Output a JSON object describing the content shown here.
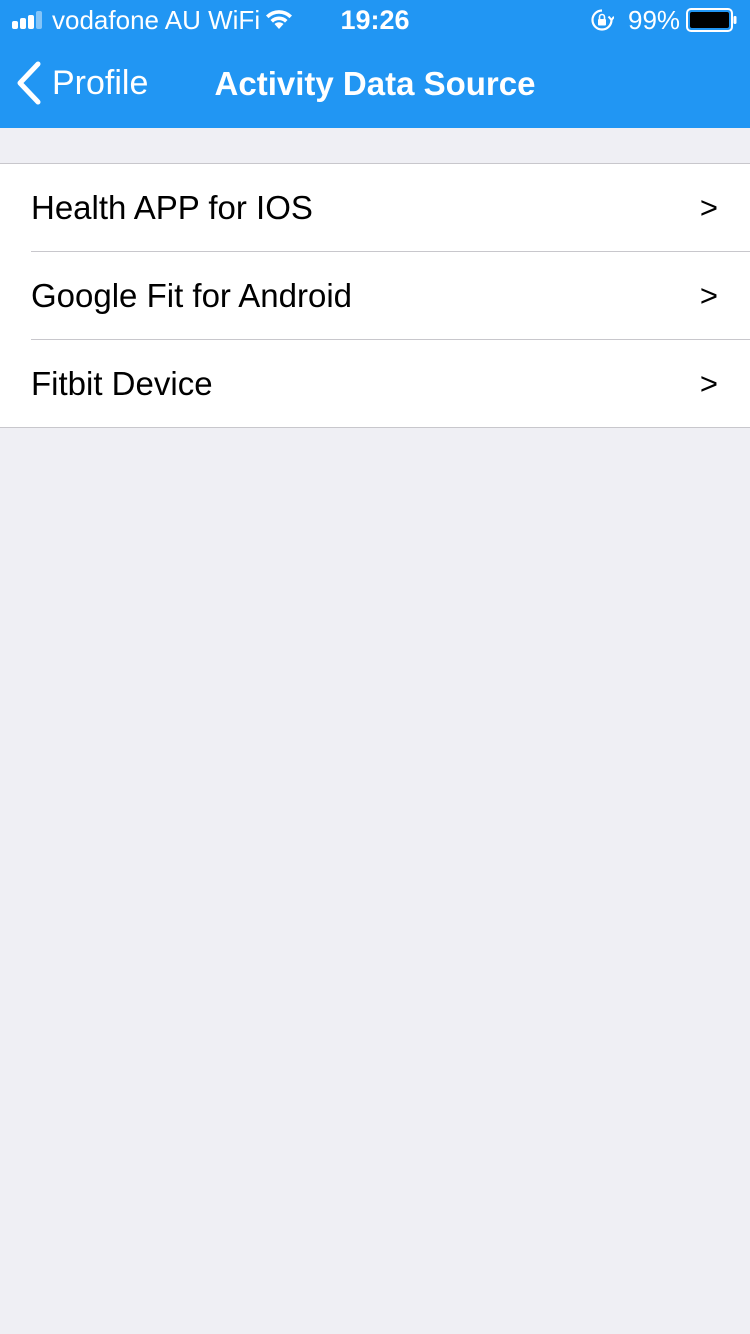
{
  "status_bar": {
    "carrier": "vodafone AU WiFi",
    "time": "19:26",
    "battery_percent": "99%",
    "signal_bars": 4,
    "signal_bars_filled": 3,
    "icons": [
      "signal-icon",
      "wifi-icon",
      "orientation-lock-icon",
      "battery-icon"
    ]
  },
  "nav": {
    "back_label": "Profile",
    "back_icon": "chevron-left-icon",
    "title": "Activity Data Source"
  },
  "list": {
    "items": [
      {
        "label": "Health APP for IOS",
        "chevron": ">"
      },
      {
        "label": "Google Fit for Android",
        "chevron": ">"
      },
      {
        "label": "Fitbit Device",
        "chevron": ">"
      }
    ]
  },
  "colors": {
    "accent": "#2196f3",
    "background": "#efeff4",
    "separator": "#c8c7cc",
    "cell": "#ffffff"
  }
}
